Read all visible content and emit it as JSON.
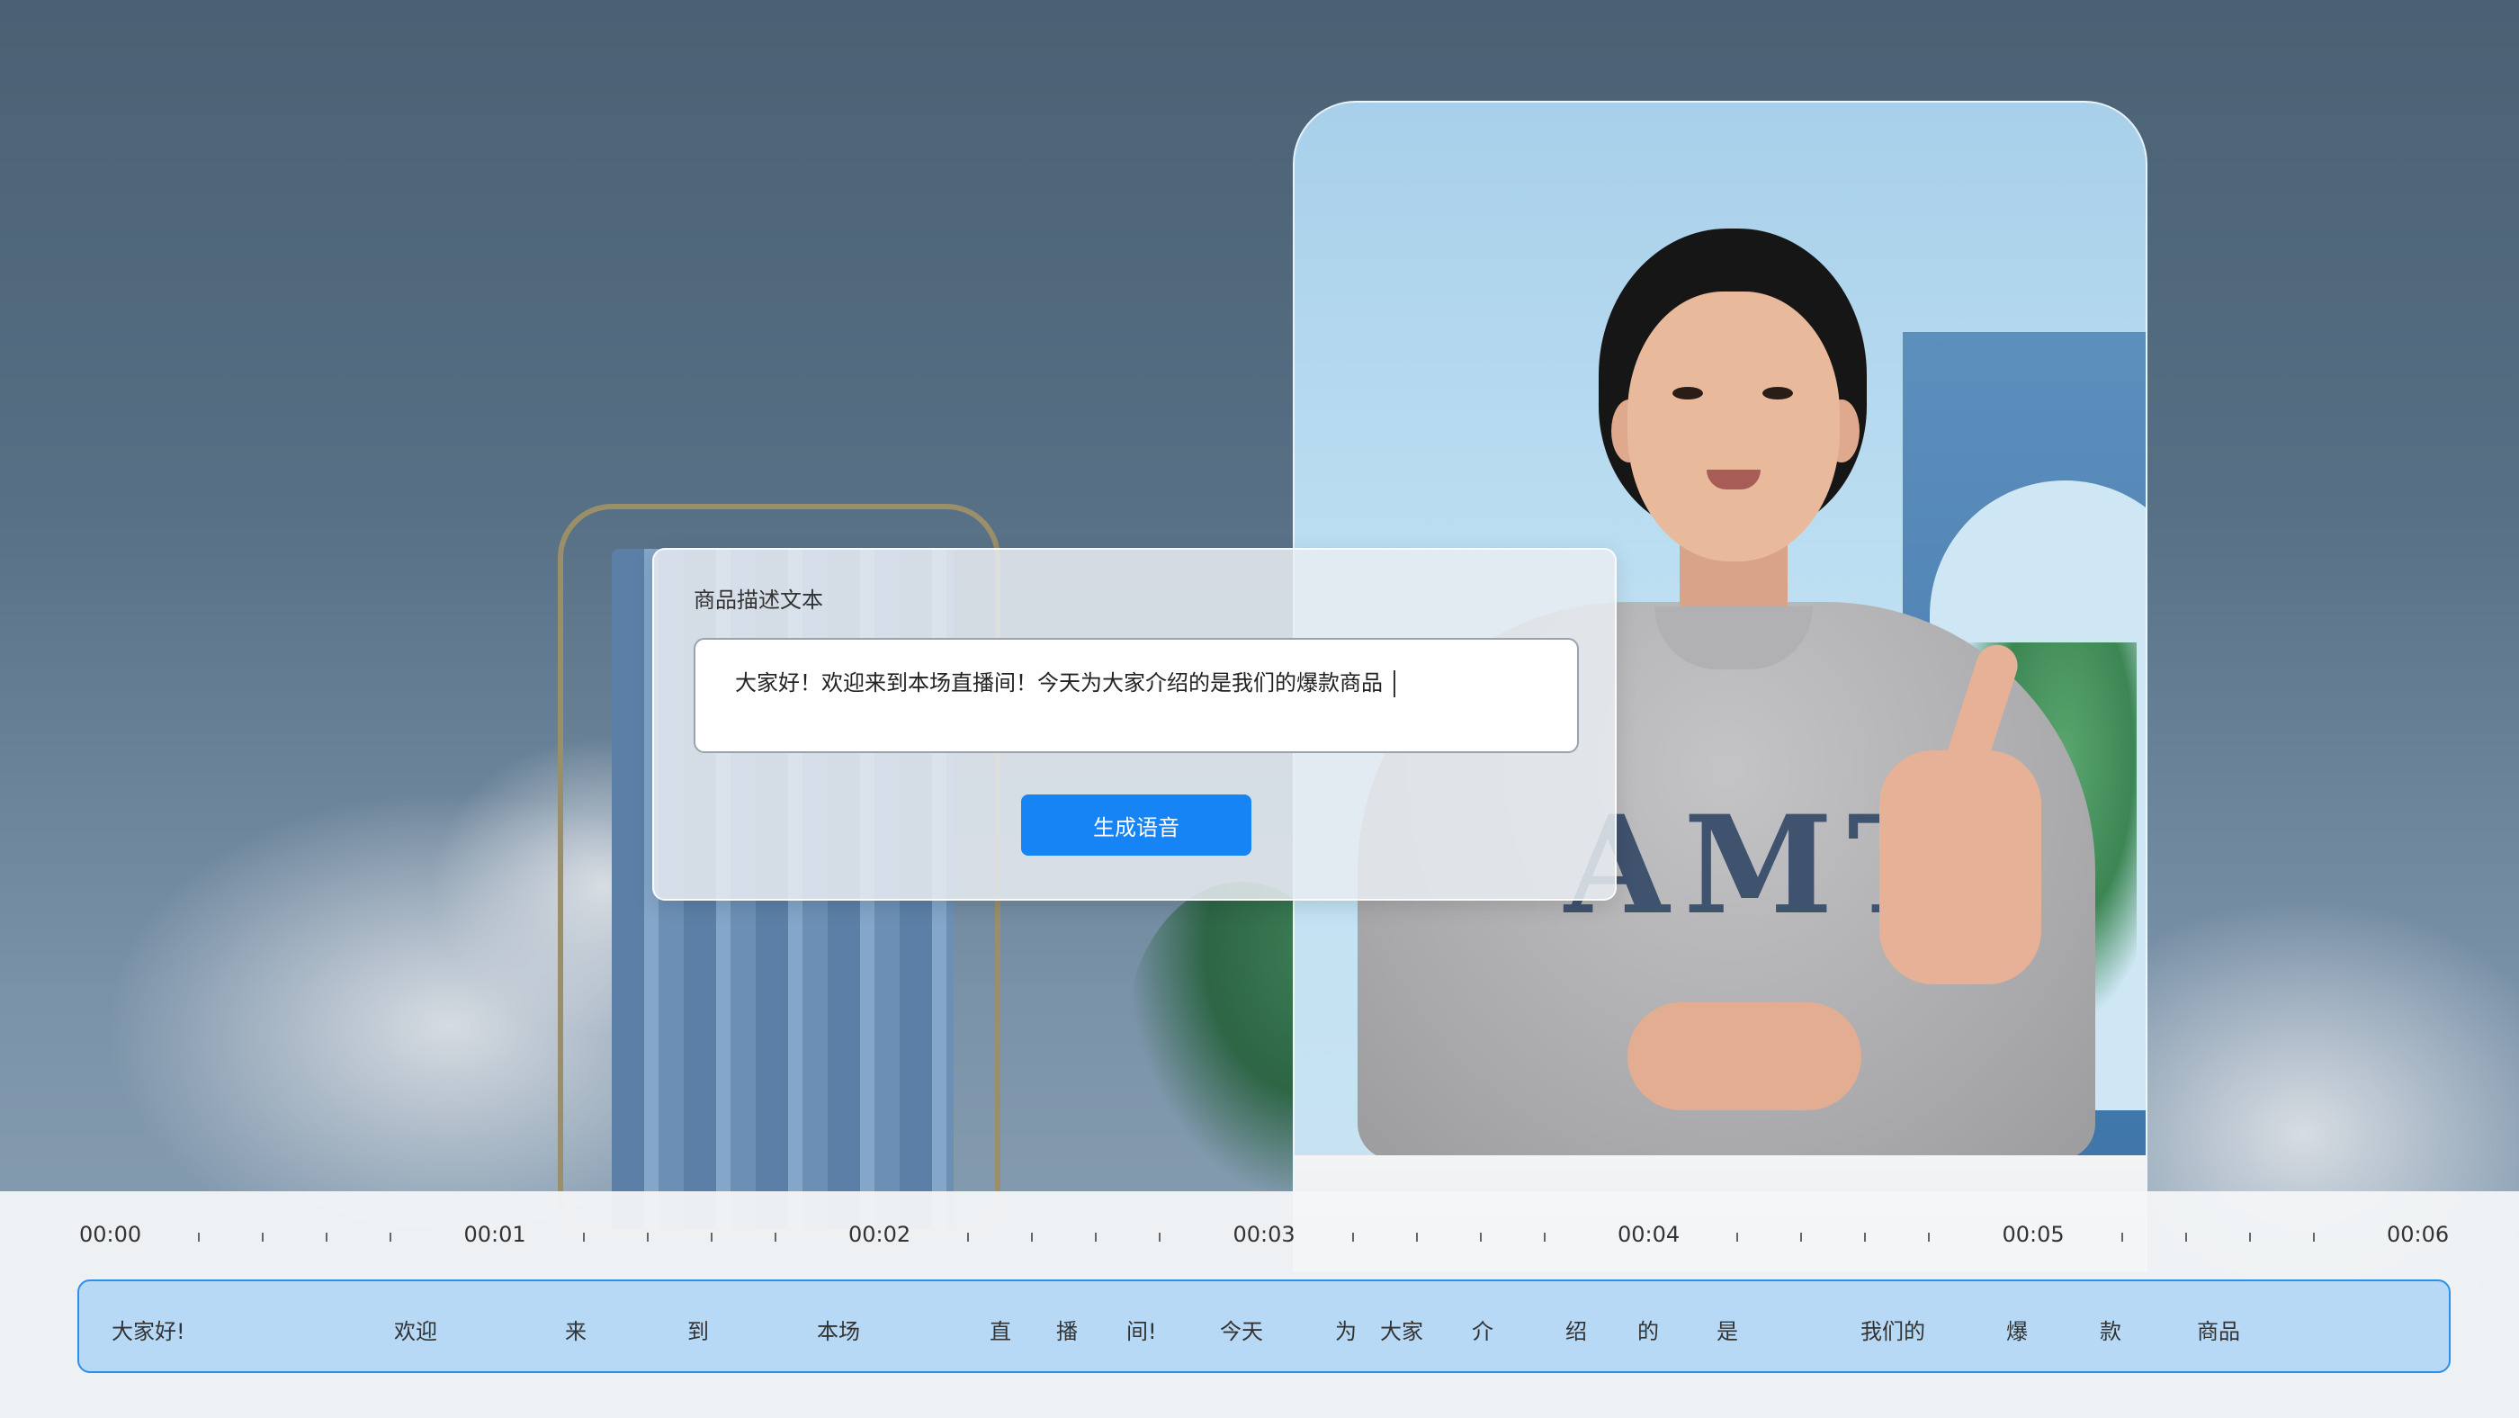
{
  "dialog": {
    "title": "商品描述文本",
    "text_value": "大家好！欢迎来到本场直播间！今天为大家介绍的是我们的爆款商品",
    "generate_button": "生成语音"
  },
  "avatar_preview": {
    "shirt_text": "AMT"
  },
  "timeline": {
    "time_labels": [
      "00:00",
      "00:01",
      "00:02",
      "00:03",
      "00:04",
      "00:05",
      "00:06"
    ],
    "words": [
      "大家好!",
      "欢迎",
      "来",
      "到",
      "本场",
      "直",
      "播",
      "间!",
      "今天",
      "为",
      "大家",
      "介",
      "绍",
      "的",
      "是",
      "我们的",
      "爆",
      "款",
      "商品"
    ]
  },
  "colors": {
    "accent": "#1684f5",
    "track_fill": "#b7d9f5",
    "track_border": "#2c8fe8"
  }
}
